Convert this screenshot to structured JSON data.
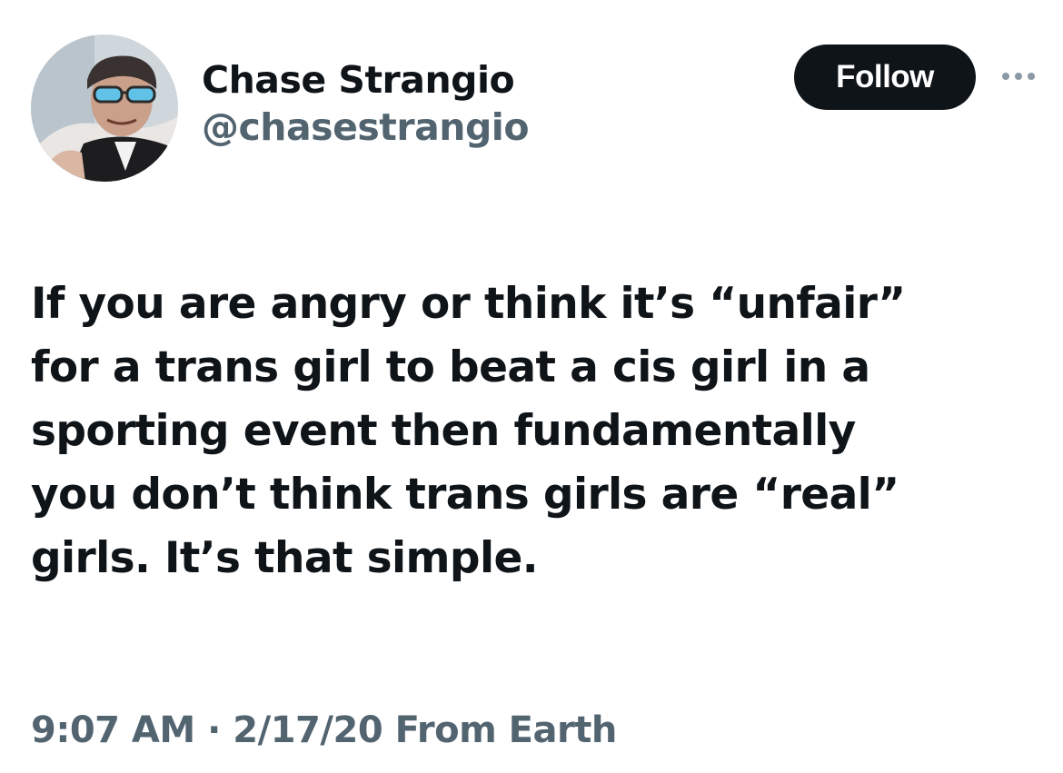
{
  "author": {
    "display_name": "Chase Strangio",
    "handle": "@chasestrangio"
  },
  "follow_button": {
    "label": "Follow"
  },
  "more_menu": {
    "icon": "more-horizontal-icon"
  },
  "tweet": {
    "text": "If you are angry or think it’s “unfair”\nfor a trans girl to beat a cis girl in a\nsporting event then fundamentally\nyou don’t think trans girls are “real”\ngirls. It’s that simple.",
    "time": "9:07 AM",
    "separator": "·",
    "date": "2/17/20",
    "source": "From Earth"
  },
  "colors": {
    "text_primary": "#0f1419",
    "text_secondary": "#536471",
    "button_bg": "#0f1419",
    "button_text": "#ffffff",
    "background": "#ffffff"
  }
}
